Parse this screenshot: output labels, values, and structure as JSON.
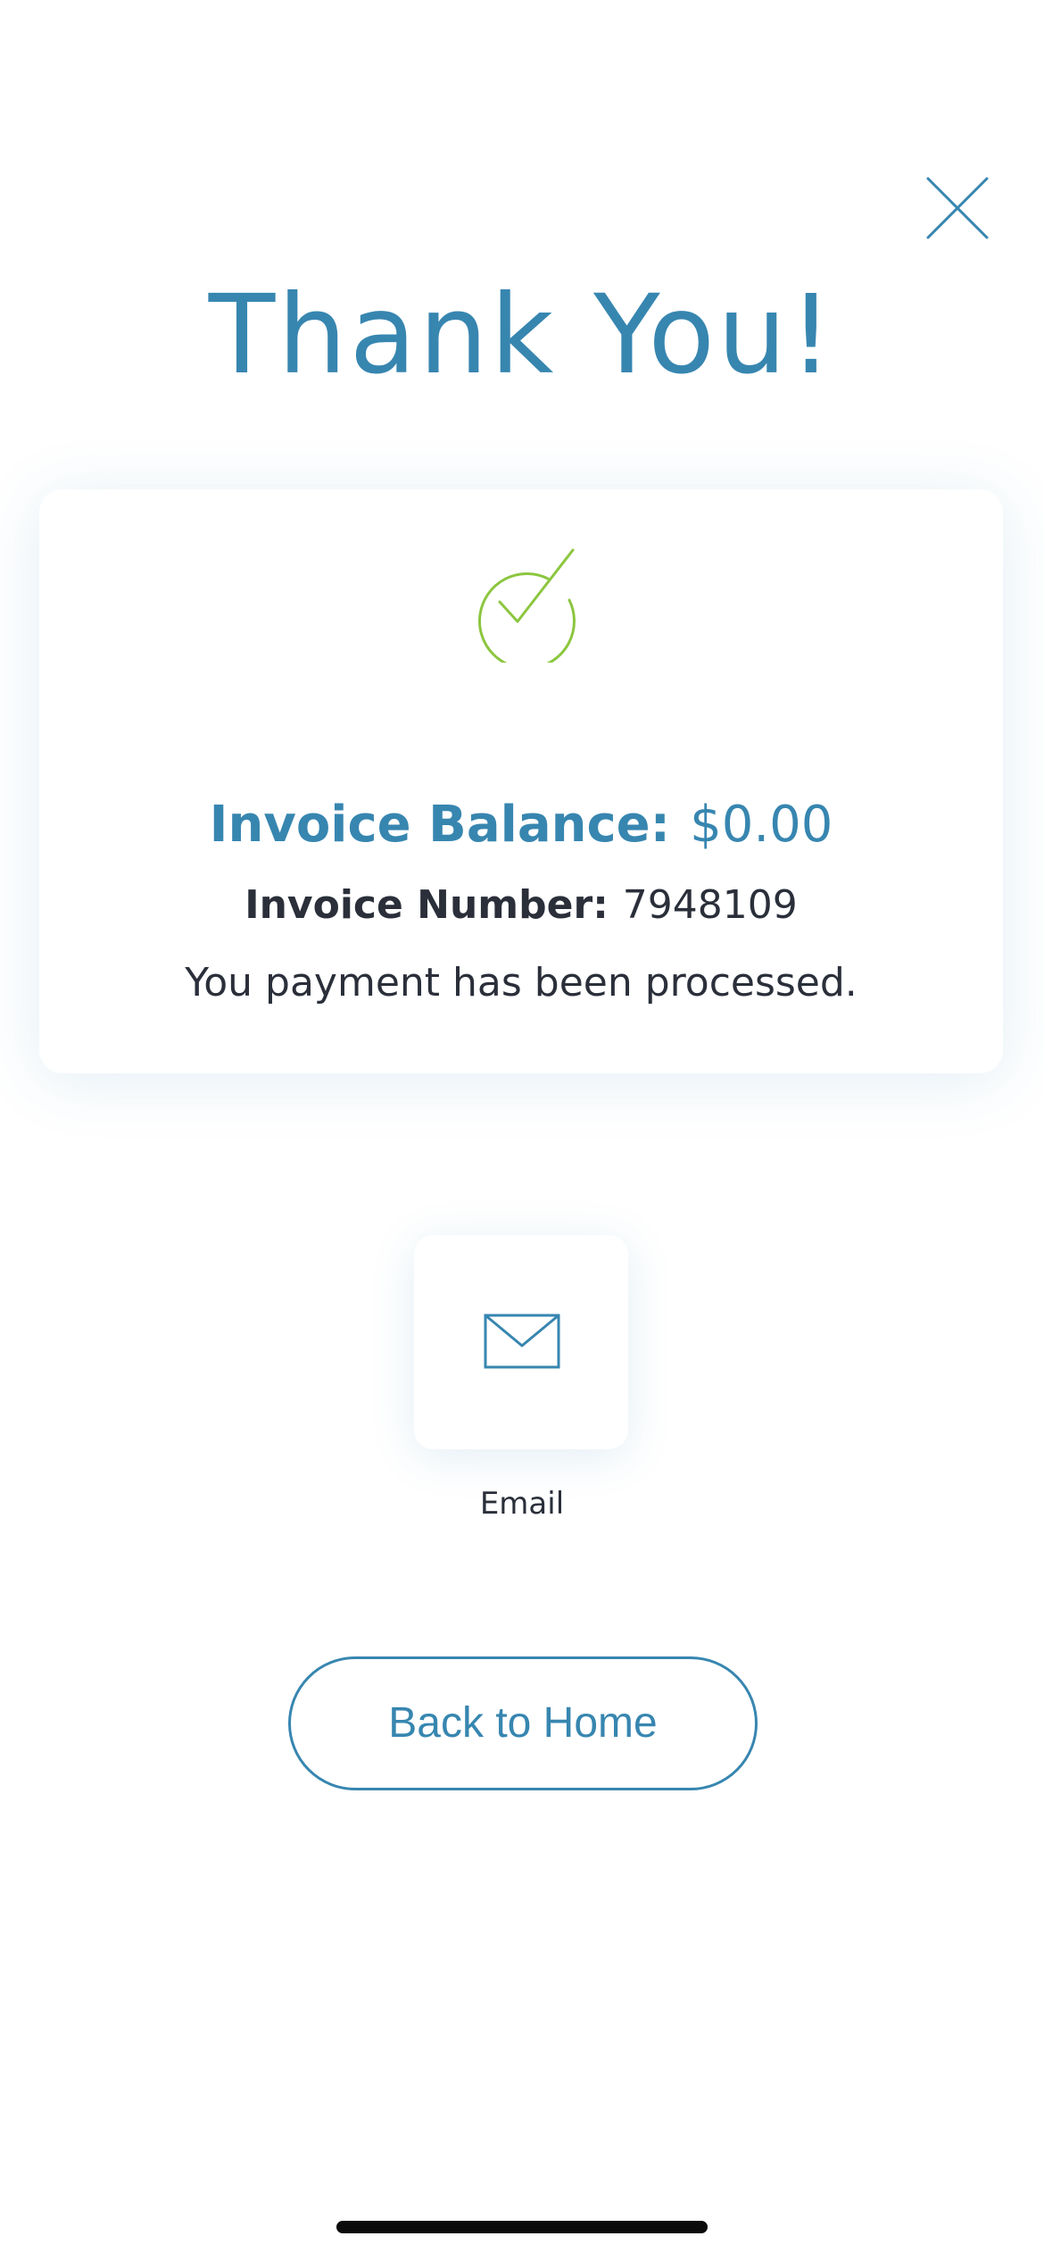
{
  "header": {
    "close_icon": "close-icon",
    "title": "Thank You!"
  },
  "receipt": {
    "status_icon": "check-circle-icon",
    "balance_label": "Invoice Balance",
    "balance_value": "$0.00",
    "number_label": "Invoice Number",
    "number_value": "7948109",
    "message": "You payment has been processed."
  },
  "share": {
    "icon": "mail-icon",
    "label": "Email"
  },
  "actions": {
    "home_label": "Back to Home"
  },
  "colors": {
    "accent": "#3786b0",
    "success": "#8cc63f",
    "text": "#2a2f3a",
    "background": "#ffffff"
  }
}
